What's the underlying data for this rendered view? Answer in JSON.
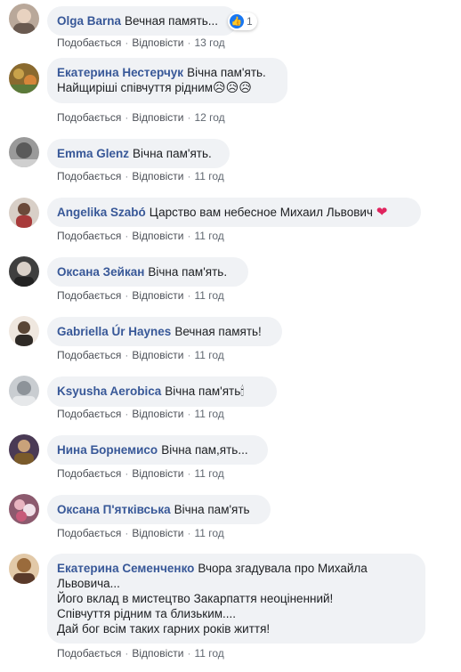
{
  "labels": {
    "like": "Подобається",
    "reply": "Відповісти",
    "sep": "·"
  },
  "comments": [
    {
      "author": "Olga Barna",
      "text": "Вечная память...",
      "time": "13 год",
      "reaction_count": "1",
      "avatar_color": "#b9a89a"
    },
    {
      "author": "Екатерина Нестерчук",
      "text": "Вічна пам'ять.\nНайщиріші співчуття рідним",
      "time": "12 год",
      "emoji": "😥😥😥",
      "avatar_color": "#8a6a2f"
    },
    {
      "author": "Emma Glenz",
      "text": "Вічна пам'ять.",
      "time": "11 год",
      "avatar_color": "#7d7d7d"
    },
    {
      "author": "Angelika Szabó",
      "text": "Царство вам небесное Михаил Львович",
      "time": "11 год",
      "heart": "❤",
      "avatar_color": "#6b4a3a"
    },
    {
      "author": "Оксана Зейкан",
      "text": "Вічна пам'ять.",
      "time": "11 год",
      "avatar_color": "#3f3f3f"
    },
    {
      "author": "Gabriella Úr Haynes",
      "text": "Вечная память!",
      "time": "11 год",
      "avatar_color": "#5a4636"
    },
    {
      "author": "Ksyusha Aerobica",
      "text": "Вічна пам'ять",
      "time": "11 год",
      "emoji": "🕯",
      "avatar_color": "#a7adb3"
    },
    {
      "author": "Нина Борнемисо",
      "text": "Вічна пам,ять...",
      "time": "11 год",
      "avatar_color": "#4a3a55"
    },
    {
      "author": "Оксана П'ятківська",
      "text": "Вічна пам'ять",
      "time": "11 год",
      "avatar_color": "#8c5a6e"
    },
    {
      "author": "Екатерина Семенченко",
      "text": "Вчора згадувала про Михайла Львовича...\nЙого вклад в мистецтво Закарпаття неоціненний!\nСпівчуття рідним та близьким....\nДай бог всім таких гарних років життя!",
      "time": "11 год",
      "avatar_color": "#9a6b3c"
    }
  ]
}
